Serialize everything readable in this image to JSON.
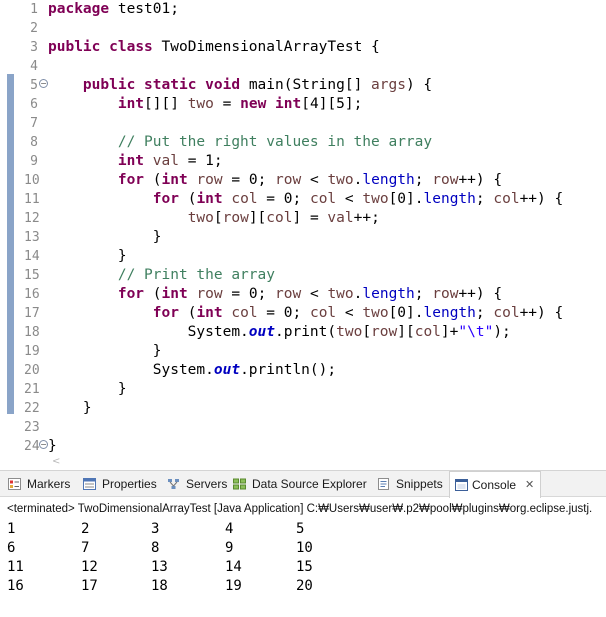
{
  "editor": {
    "lines": [
      {
        "n": "1",
        "html": "<span class=\"kw\">package</span> test01;"
      },
      {
        "n": "2",
        "html": ""
      },
      {
        "n": "3",
        "html": "<span class=\"kw\">public</span> <span class=\"kw\">class</span> TwoDimensionalArrayTest {"
      },
      {
        "n": "4",
        "html": ""
      },
      {
        "n": "5",
        "html": "    <span class=\"kw\">public</span> <span class=\"kw\">static</span> <span class=\"kw\">void</span> main(String[] <span class=\"lv\">args</span>) {",
        "fold": "⊖"
      },
      {
        "n": "6",
        "html": "        <span class=\"kw\">int</span>[][] <span class=\"lv\">two</span> = <span class=\"kw\">new</span> <span class=\"kw\">int</span>[4][5];"
      },
      {
        "n": "7",
        "html": ""
      },
      {
        "n": "8",
        "html": "        <span class=\"cm\">// Put the right values in the array</span>"
      },
      {
        "n": "9",
        "html": "        <span class=\"kw\">int</span> <span class=\"lv\">val</span> = 1;"
      },
      {
        "n": "10",
        "html": "        <span class=\"kw\">for</span> (<span class=\"kw\">int</span> <span class=\"lv\">row</span> = 0; <span class=\"lv\">row</span> &lt; <span class=\"lv\">two</span>.<span class=\"fd\">length</span>; <span class=\"lv\">row</span>++) {"
      },
      {
        "n": "11",
        "html": "            <span class=\"kw\">for</span> (<span class=\"kw\">int</span> <span class=\"lv\">col</span> = 0; <span class=\"lv\">col</span> &lt; <span class=\"lv\">two</span>[0].<span class=\"fd\">length</span>; <span class=\"lv\">col</span>++) {"
      },
      {
        "n": "12",
        "html": "                <span class=\"lv\">two</span>[<span class=\"lv\">row</span>][<span class=\"lv\">col</span>] = <span class=\"lv\">val</span>++;"
      },
      {
        "n": "13",
        "html": "            }"
      },
      {
        "n": "14",
        "html": "        }"
      },
      {
        "n": "15",
        "html": "        <span class=\"cm\">// Print the array</span>"
      },
      {
        "n": "16",
        "html": "        <span class=\"kw\">for</span> (<span class=\"kw\">int</span> <span class=\"lv\">row</span> = 0; <span class=\"lv\">row</span> &lt; <span class=\"lv\">two</span>.<span class=\"fd\">length</span>; <span class=\"lv\">row</span>++) {"
      },
      {
        "n": "17",
        "html": "            <span class=\"kw\">for</span> (<span class=\"kw\">int</span> <span class=\"lv\">col</span> = 0; <span class=\"lv\">col</span> &lt; <span class=\"lv\">two</span>[0].<span class=\"fd\">length</span>; <span class=\"lv\">col</span>++) {"
      },
      {
        "n": "18",
        "html": "                System.<span class=\"sf\">out</span>.print(<span class=\"lv\">two</span>[<span class=\"lv\">row</span>][<span class=\"lv\">col</span>]+<span class=\"st\">\"\\t\"</span>);"
      },
      {
        "n": "19",
        "html": "            }"
      },
      {
        "n": "20",
        "html": "            System.<span class=\"sf\">out</span>.println();"
      },
      {
        "n": "21",
        "html": "        }"
      },
      {
        "n": "22",
        "html": "    }"
      },
      {
        "n": "23",
        "html": ""
      },
      {
        "n": "24",
        "html": "}",
        "fold": "⊖"
      }
    ]
  },
  "tabs": [
    {
      "label": "Markers",
      "icon": "markers-icon"
    },
    {
      "label": "Properties",
      "icon": "properties-icon"
    },
    {
      "label": "Servers",
      "icon": "servers-icon"
    },
    {
      "label": "Data Source Explorer",
      "icon": "data-source-explorer-icon"
    },
    {
      "label": "Snippets",
      "icon": "snippets-icon"
    },
    {
      "label": "Console",
      "icon": "console-icon",
      "active": true
    }
  ],
  "console": {
    "status": "<terminated> TwoDimensionalArrayTest [Java Application] C:₩Users₩user₩.p2₩pool₩plugins₩org.eclipse.justj.",
    "rows": [
      [
        "1",
        "2",
        "3",
        "4",
        "5"
      ],
      [
        "6",
        "7",
        "8",
        "9",
        "10"
      ],
      [
        "11",
        "12",
        "13",
        "14",
        "15"
      ],
      [
        "16",
        "17",
        "18",
        "19",
        "20"
      ]
    ]
  },
  "colors": {
    "keyword": "#7f0055",
    "comment": "#3f7f5f",
    "field": "#0000c0",
    "string": "#2a00ff",
    "local_variable": "#6a3e3e",
    "gutter_marker": "#8aa4c8"
  }
}
